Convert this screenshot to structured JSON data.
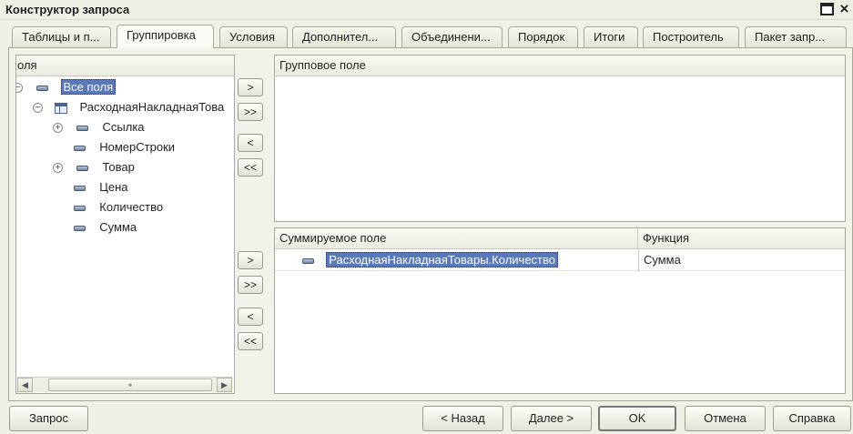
{
  "window": {
    "title": "Конструктор запроса"
  },
  "tabs": [
    {
      "label": "Таблицы и п..."
    },
    {
      "label": "Группировка"
    },
    {
      "label": "Условия"
    },
    {
      "label": "Дополнител..."
    },
    {
      "label": "Объединени..."
    },
    {
      "label": "Порядок"
    },
    {
      "label": "Итоги"
    },
    {
      "label": "Построитель"
    },
    {
      "label": "Пакет запр..."
    }
  ],
  "active_tab": "Группировка",
  "fields_panel": {
    "header": "оля",
    "root": {
      "label": "Все поля",
      "expander": "−"
    },
    "table": {
      "label": "РасходнаяНакладнаяТова",
      "expander": "−"
    },
    "items": [
      {
        "label": "Ссылка",
        "expander": "+"
      },
      {
        "label": "НомерСтроки",
        "expander": ""
      },
      {
        "label": "Товар",
        "expander": "+"
      },
      {
        "label": "Цена",
        "expander": ""
      },
      {
        "label": "Количество",
        "expander": ""
      },
      {
        "label": "Сумма",
        "expander": ""
      }
    ]
  },
  "group_buttons": {
    "add": ">",
    "add_all": ">>",
    "remove": "<",
    "remove_all": "<<"
  },
  "sum_buttons": {
    "add": ">",
    "add_all": ">>",
    "remove": "<",
    "remove_all": "<<"
  },
  "group_panel": {
    "header": "Групповое поле"
  },
  "sum_panel": {
    "columns": [
      "Суммируемое поле",
      "Функция"
    ],
    "rows": [
      {
        "field": "РасходнаяНакладнаяТовары.Количество",
        "function": "Сумма"
      }
    ]
  },
  "scrollbar": {
    "left_arrow": "◀",
    "right_arrow": "▶",
    "grip": "⦁"
  },
  "footer": {
    "query": "Запрос",
    "back": "< Назад",
    "next": "Далее >",
    "ok": "OK",
    "cancel": "Отмена",
    "help": "Справка"
  }
}
